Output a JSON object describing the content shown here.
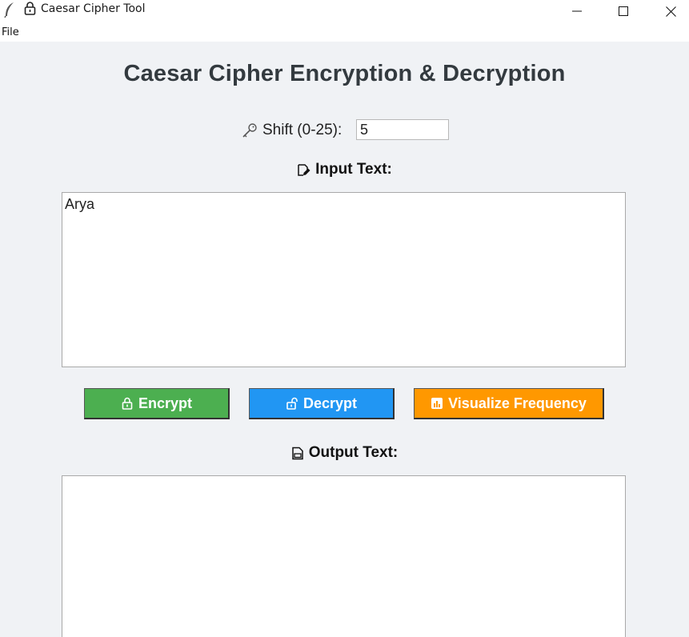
{
  "window": {
    "title": "Caesar Cipher Tool",
    "app_icon": "feather-icon",
    "title_icon": "lock-icon",
    "controls": [
      "minimize-icon",
      "maximize-icon",
      "close-icon"
    ]
  },
  "menu": {
    "items": [
      "File"
    ]
  },
  "main": {
    "heading": "Caesar Cipher Encryption & Decryption",
    "shift": {
      "icon": "key-icon",
      "label": "Shift (0-25):",
      "value": "5"
    },
    "input": {
      "icon": "edit-icon",
      "label": "Input Text:",
      "value": "Arya"
    },
    "buttons": [
      {
        "icon": "lock-icon",
        "label": "Encrypt",
        "color": "#4caf50"
      },
      {
        "icon": "unlock-icon",
        "label": "Decrypt",
        "color": "#2196f3"
      },
      {
        "icon": "chart-icon",
        "label": "Visualize Frequency",
        "color": "#ff9800"
      }
    ],
    "output": {
      "icon": "document-icon",
      "label": "Output Text:",
      "value": ""
    }
  }
}
